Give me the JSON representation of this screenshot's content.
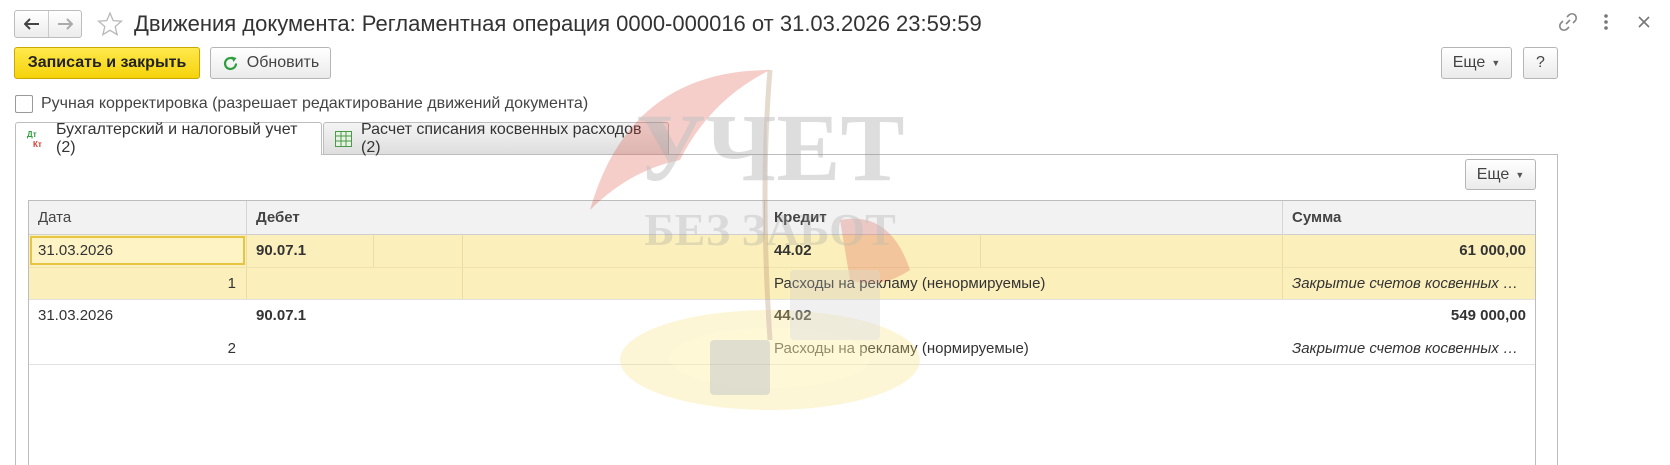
{
  "window": {
    "title": "Движения документа: Регламентная операция 0000-000016 от 31.03.2026 23:59:59"
  },
  "toolbar": {
    "save_close_label": "Записать и закрыть",
    "refresh_label": "Обновить",
    "more_label": "Еще",
    "help_label": "?"
  },
  "manual_edit": {
    "label": "Ручная корректировка (разрешает редактирование движений документа)",
    "checked": false
  },
  "tabs": [
    {
      "label": "Бухгалтерский и налоговый учет (2)",
      "active": true,
      "icon": "dt-kt-icon"
    },
    {
      "label": "Расчет списания косвенных расходов (2)",
      "active": false,
      "icon": "table-icon"
    }
  ],
  "table_toolbar": {
    "more_label": "Еще"
  },
  "table": {
    "columns": [
      "Дата",
      "Дебет",
      "Кредит",
      "Сумма"
    ],
    "rows": [
      {
        "date": "31.03.2026",
        "number": "1",
        "debit": "90.07.1",
        "credit": "44.02",
        "credit_sub": "Расходы на рекламу (ненормируемые)",
        "amount": "61 000,00",
        "comment": "Закрытие счетов косвенных расходов",
        "selected": true
      },
      {
        "date": "31.03.2026",
        "number": "2",
        "debit": "90.07.1",
        "credit": "44.02",
        "credit_sub": "Расходы на рекламу (нормируемые)",
        "amount": "549 000,00",
        "comment": "Закрытие счетов косвенных расходов",
        "selected": false
      }
    ]
  },
  "watermark": {
    "line1": "УЧЕТ",
    "line2": "БЕЗ ЗАБОТ"
  },
  "colors": {
    "primary_button": "#f5d30b",
    "selected_row": "#fbefbc",
    "refresh_icon": "#2e9e3e"
  }
}
